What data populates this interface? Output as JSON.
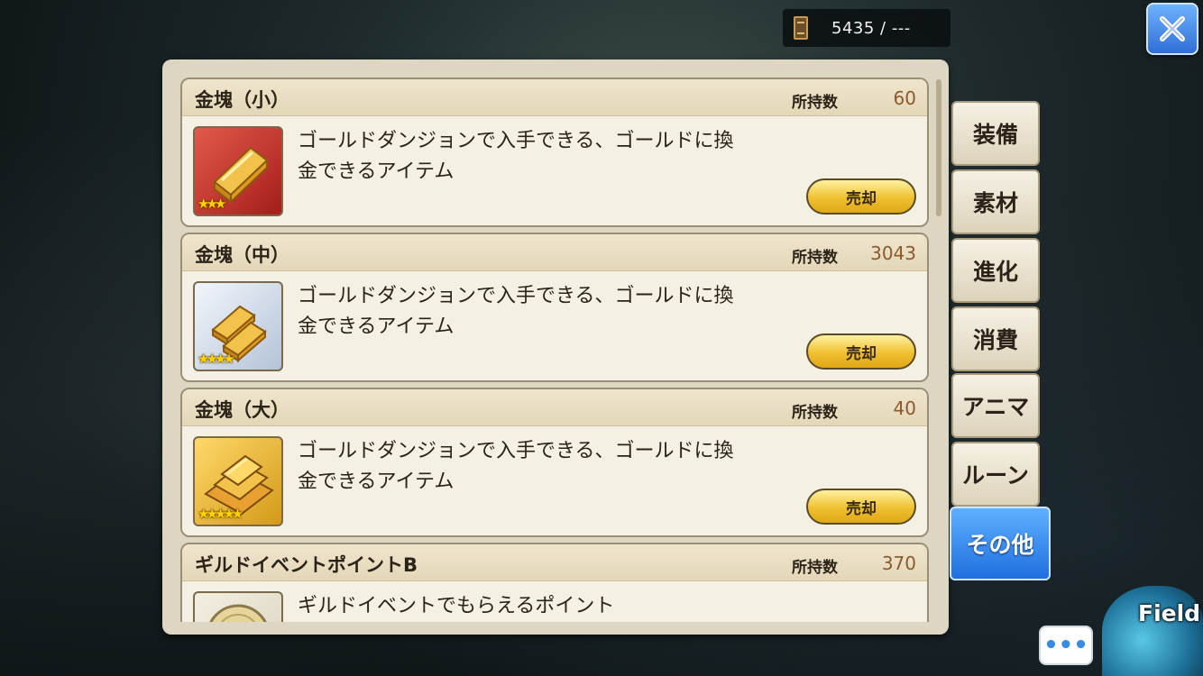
{
  "header": {
    "currency_value": "5435 / ---"
  },
  "items": [
    {
      "title": "金塊（小）",
      "owned_label": "所持数",
      "owned_value": "60",
      "desc_line1": "ゴールドダンジョンで入手できる、ゴールドに換",
      "desc_line2": "金できるアイテム",
      "stars": "★★★",
      "sell_label": "売却"
    },
    {
      "title": "金塊（中）",
      "owned_label": "所持数",
      "owned_value": "3043",
      "desc_line1": "ゴールドダンジョンで入手できる、ゴールドに換",
      "desc_line2": "金できるアイテム",
      "stars": "★★★★",
      "sell_label": "売却"
    },
    {
      "title": "金塊（大）",
      "owned_label": "所持数",
      "owned_value": "40",
      "desc_line1": "ゴールドダンジョンで入手できる、ゴールドに換",
      "desc_line2": "金できるアイテム",
      "stars": "★★★★★",
      "sell_label": "売却"
    },
    {
      "title": "ギルドイベントポイントB",
      "owned_label": "所持数",
      "owned_value": "370",
      "desc_line1": "ギルドイベントでもらえるポイント"
    }
  ],
  "tabs": [
    {
      "label": "装備"
    },
    {
      "label": "素材"
    },
    {
      "label": "進化"
    },
    {
      "label": "消費"
    },
    {
      "label": "アニマ"
    },
    {
      "label": "ルーン"
    },
    {
      "label": "その他",
      "active": true
    }
  ],
  "footer": {
    "chat_label": "•••",
    "field_label": "Field"
  },
  "colors": {
    "panel": "#ddd6c3",
    "card": "#f4f0e4",
    "active_tab": "#1f6fe0",
    "sell_button": "#f0c030"
  },
  "icons": [
    "ticket-icon",
    "close-icon",
    "gold-bar-icon",
    "gold-bars-icon",
    "gold-stack-icon",
    "coin-icon",
    "chat-icon"
  ]
}
